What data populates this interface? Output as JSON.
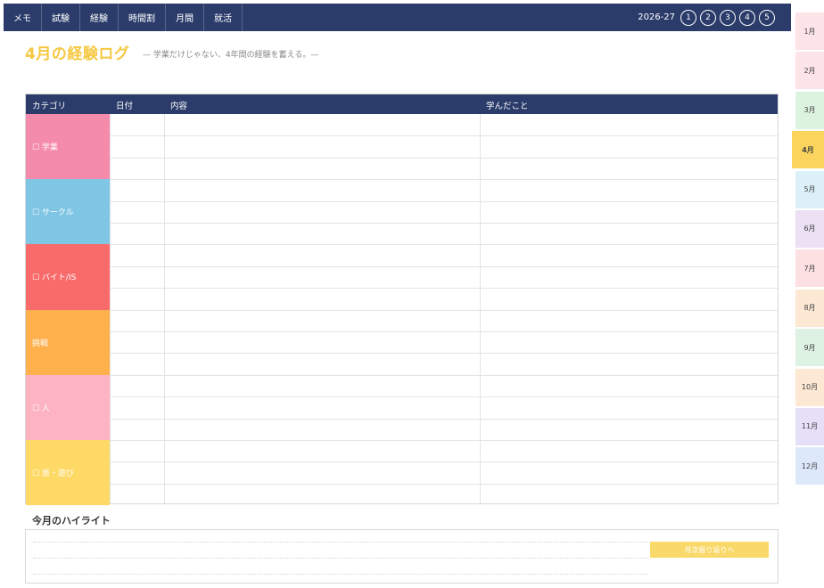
{
  "nav": {
    "items": [
      "メモ",
      "試験",
      "経験",
      "時間割",
      "月間",
      "就活"
    ],
    "year": "2026-27",
    "circles": [
      "1",
      "2",
      "3",
      "4",
      "5"
    ]
  },
  "tabs": [
    {
      "label": "1月",
      "color": "#fde4e8"
    },
    {
      "label": "2月",
      "color": "#fde4e8"
    },
    {
      "label": "3月",
      "color": "#dcf3df"
    },
    {
      "label": "4月",
      "color": "#fad45d"
    },
    {
      "label": "5月",
      "color": "#dcf0f9"
    },
    {
      "label": "6月",
      "color": "#ece0f4"
    },
    {
      "label": "7月",
      "color": "#fde0e2"
    },
    {
      "label": "8月",
      "color": "#fde8d4"
    },
    {
      "label": "9月",
      "color": "#ddf2e2"
    },
    {
      "label": "10月",
      "color": "#fde8d4"
    },
    {
      "label": "11月",
      "color": "#e6dff8"
    },
    {
      "label": "12月",
      "color": "#dde8fb"
    }
  ],
  "active_tab": 3,
  "page": {
    "title": "4月の経験ログ",
    "subtitle": "— 学業だけじゃない、4年間の経験を蓄える。—"
  },
  "table": {
    "headers": [
      "カテゴリ",
      "日付",
      "内容",
      "学んだこと"
    ],
    "categories": [
      {
        "label": "☐ 学業",
        "color": "#f58bab"
      },
      {
        "label": "☐ サークル",
        "color": "#7fc6e4"
      },
      {
        "label": "☐ バイト/IS",
        "color": "#f96a6a"
      },
      {
        "label": "挑戦",
        "color": "#fdb04b"
      },
      {
        "label": "☐ 人",
        "color": "#fdb3c2"
      },
      {
        "label": "☐ 旅・遊び",
        "color": "#fed966"
      }
    ]
  },
  "highlight": {
    "label": "今月のハイライト",
    "button": "月次振り返りへ"
  }
}
